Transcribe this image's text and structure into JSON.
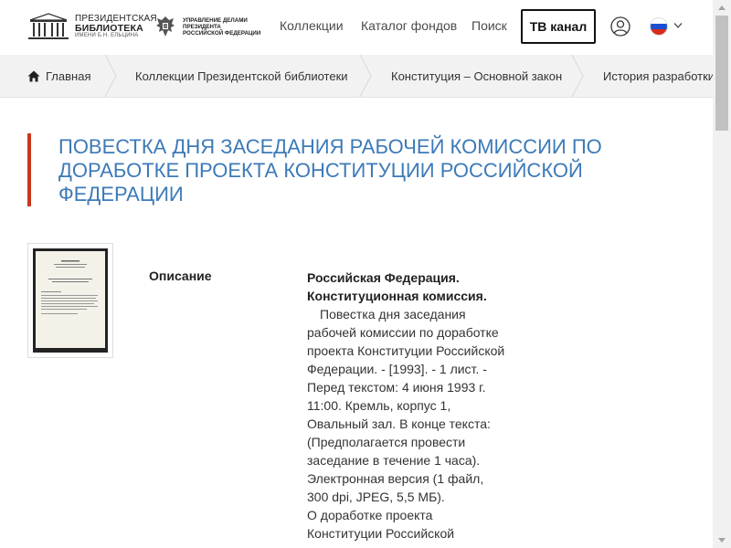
{
  "header": {
    "logo": {
      "line1": "ПРЕЗИДЕНТСКАЯ",
      "line2": "БИБЛИОТЕКА",
      "line3": "ИМЕНИ Б.Н. ЕЛЬЦИНА"
    },
    "logo2": {
      "line1": "УПРАВЛЕНИЕ ДЕЛАМИ ПРЕЗИДЕНТА",
      "line2": "РОССИЙСКОЙ ФЕДЕРАЦИИ"
    },
    "nav": [
      "Коллекции",
      "Каталог фондов",
      "Поиск"
    ],
    "tv_button": "ТВ канал",
    "user_icon": "user-icon",
    "language_flag": "russia-flag"
  },
  "breadcrumbs": [
    "Главная",
    "Коллекции Президентской библиотеки",
    "Конституция – Основной закон",
    "История разработки"
  ],
  "page": {
    "title": "Повестка дня заседания рабочей комиссии по доработке проекта Конституции Российской Федерации",
    "description_label": "Описание",
    "description_heading": "Российская Федерация. Конституционная комиссия.",
    "description_text": "Повестка дня заседания рабочей комиссии по доработке проекта Конституции Российской Федерации. - [1993]. - 1 лист. - Перед текстом: 4 июня 1993 г. 11:00. Кремль, корпус 1, Овальный зал. В конце текста: (Предполагается провести заседание в течение 1 часа). Электронная версия (1 файл, 300 dpi, JPEG, 5,5 МБ).",
    "description_more": "О доработке проекта Конституции Российской"
  },
  "colors": {
    "accent": "#c8371f",
    "title": "#3c7ab8",
    "breadcrumb_bg": "#f2f2f2"
  }
}
